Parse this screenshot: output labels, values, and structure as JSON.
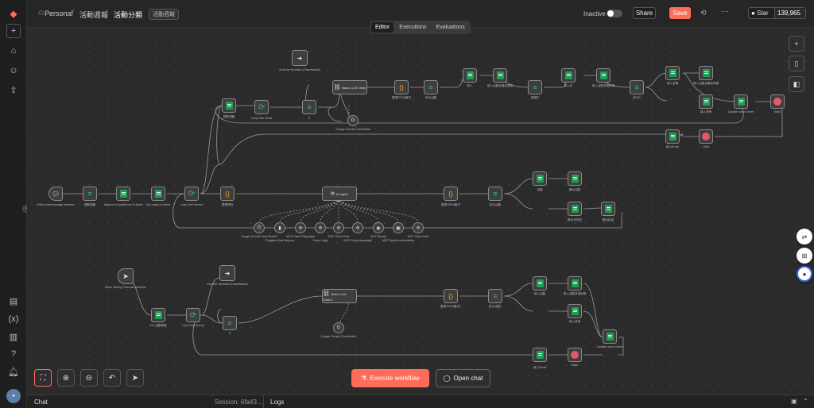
{
  "breadcrumb": {
    "owner": "Personal",
    "project": "活動週報",
    "workflow": "活動分類",
    "tag": "活動週報"
  },
  "header": {
    "inactive_label": "Inactive",
    "share_label": "Share",
    "save_label": "Save",
    "star_label": "Star",
    "star_count": "139,965"
  },
  "tabs": [
    "Editor",
    "Executions",
    "Evaluations"
  ],
  "buttons": {
    "execute": "Execute workflow",
    "open_chat": "Open chat"
  },
  "bottom": {
    "chat_label": "Chat",
    "session": "Session: 6fa43...",
    "logs_label": "Logs"
  },
  "nodes": {
    "chat_trigger": "When chat message received",
    "sheet_a": "提取週報",
    "append_sheet": "Append or update row in sheet",
    "set_row": "Get row(s) in sheet",
    "loop1": "Loop Over Items1",
    "code1": "整理資料",
    "ai_agent": "AI Agent",
    "code2": "整理JSON格式",
    "split2": "拆分活動",
    "r2a": "活動",
    "r2b": "轉出活動",
    "r2c": "轉出未完成",
    "r2d": "轉出結束",
    "manual_trigger": "When clicking 'Execute workflow'",
    "get_sheet": "Get 活動總覽",
    "loop3": "Loop Over Items2",
    "exec3": "Execute Workflow (Deactivated)",
    "split3": "If",
    "llm3": "Basic LLM Chain1",
    "gemini3": "Google Gemini Chat Model1",
    "code3": "整理JSON格式1",
    "split3b": "拆分活動1",
    "r3a": "填入活動",
    "r3b": "填入活動其他說明",
    "r3c": "填入其他",
    "r3d": "填入Email",
    "wait3": "Wait1",
    "upd3": "Update row in sheet",
    "top_sheet": "讀取週報",
    "loop_top": "Loop Over Items",
    "split_top": "If",
    "exec_top": "Execute Workflow (Deactivated)",
    "llm_top": "Basic LLM Chain",
    "gemini_top": "Google Gemini Chat Model",
    "code_top": "整理JSON格式",
    "split_top2": "拆分活動",
    "t1": "填入",
    "t2": "填入活動名稱及簡述",
    "t3": "週報打",
    "t4": "填入日",
    "t5": "填入活動其他說明",
    "t6": "拆分3",
    "t7": "填入名稱",
    "t8": "填入活動名稱及時間",
    "t9": "填入其他",
    "t10": "Update row in sheet",
    "t11": "Wait2",
    "t12": "填入Email",
    "t13": "Wait",
    "tools": [
      "Google Gemini Chat Model3",
      "Postgres Chat Memory",
      "MCP Client Playwright",
      "Sumo Logic",
      "MCP Client Chat",
      "MCP Client playwright",
      "MCP Spotify",
      "MCP Spotify executables",
      "MCP Client tools"
    ]
  },
  "colors": {
    "save": "#ff6d5a",
    "accent": "#ff6d5a",
    "node_border": "#8a8a8a",
    "sheet_icon": "#1f9d55",
    "wire": "#9a9a9a"
  }
}
